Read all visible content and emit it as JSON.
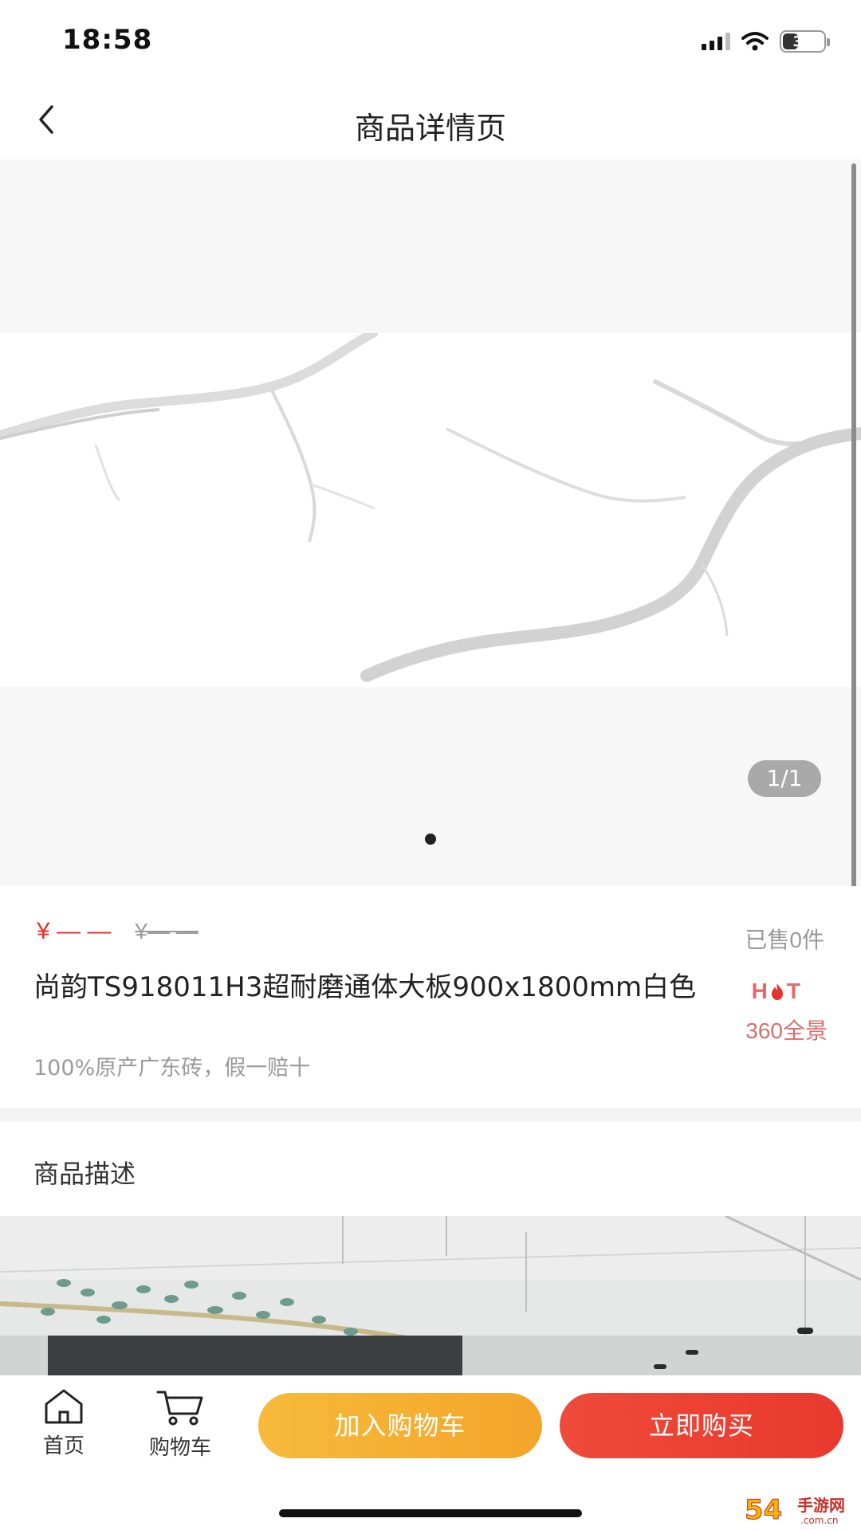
{
  "status_bar": {
    "time": "18:58",
    "battery": "38",
    "battery_level": 0.38
  },
  "nav": {
    "title": "商品详情页"
  },
  "gallery": {
    "counter": "1/1",
    "page_count": 1,
    "active_page": 1
  },
  "product": {
    "price": "¥ — —",
    "original_price": "¥— —",
    "sold": "已售0件",
    "title": "尚韵TS918011H3超耐磨通体大板900x1800mm白色",
    "tagline": "100%原产广东砖，假一赔十",
    "hot_label": {
      "left": "H",
      "right": "T"
    },
    "panorama": "360全景"
  },
  "description": {
    "title": "商品描述"
  },
  "bottom_bar": {
    "home_label": "首页",
    "cart_label": "购物车",
    "add_to_cart": "加入购物车",
    "buy_now": "立即购买"
  },
  "watermark": {
    "text": "54手游网",
    "sub": ".com.cn"
  },
  "colors": {
    "price_red": "#e5322d",
    "add_cart_orange": "#f5ad30",
    "buy_red": "#eb4133",
    "hot_red": "#e36a6a"
  },
  "icons": [
    "chevron-left-icon",
    "wifi-icon",
    "signal-icon",
    "battery-icon",
    "home-icon",
    "cart-icon",
    "flame-icon"
  ]
}
